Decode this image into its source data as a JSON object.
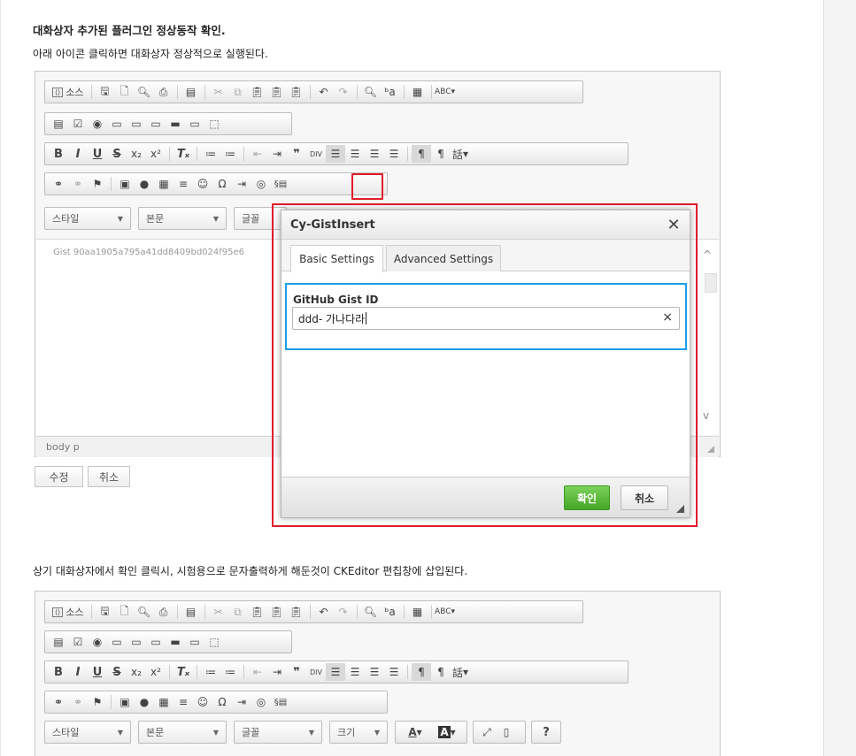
{
  "heading": "대화상자 추가된 플러그인 정상동작 확인.",
  "subtext": "아래 아이콘 클릭하면 대화상자 정상적으로 실행된다.",
  "note": "상기 대화상자에서 확인 클릭시, 시험용으로 문자출력하게 해둔것이 CKEditor 편칩창에 삽입된다.",
  "toolbar": {
    "source_label": "소스",
    "combo_style": "스타일",
    "combo_format": "본문",
    "combo_font": "글꼴",
    "combo_size": "크기",
    "div_label": "DIV",
    "lang_label": "話"
  },
  "editor1": {
    "gist_text": "Gist 90aa1905a795a41dd8409bd024f95e6",
    "status_path": "body  p"
  },
  "form": {
    "edit_label": "수정",
    "cancel_label": "취소"
  },
  "dialog": {
    "title": "Cy-GistInsert",
    "tabs": [
      "Basic Settings",
      "Advanced Settings"
    ],
    "field_label": "GitHub Gist ID",
    "field_value": "ddd- 가나다라",
    "ok_label": "확인",
    "cancel_label": "취소"
  },
  "colors": {
    "highlight_red": "#e21b2c",
    "highlight_blue": "#1aa0e8",
    "ok_green": "#45a527"
  }
}
